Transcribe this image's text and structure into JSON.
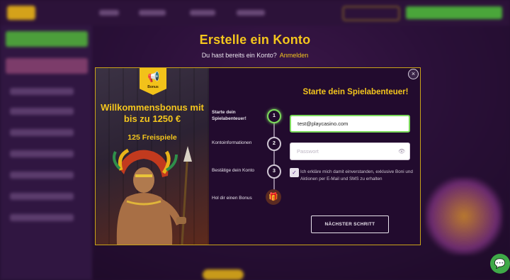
{
  "header": {
    "title": "Erstelle ein Konto",
    "subtitle": "Du hast bereits ein Konto?",
    "login_link": "Anmelden"
  },
  "promo": {
    "badge_label": "Bonus",
    "headline": "Willkommensbonus mit bis zu 1250 €",
    "freespins": "125 Freispiele"
  },
  "steps": [
    {
      "number": "1",
      "label": "Starte dein Spielabenteuer!",
      "active": true
    },
    {
      "number": "2",
      "label": "Kontoinformationen"
    },
    {
      "number": "3",
      "label": "Bestätige dein Konto"
    },
    {
      "label": "Hol dir einen Bonus",
      "icon": "gift-icon"
    }
  ],
  "form": {
    "title": "Starte dein Spielabenteuer!",
    "email_value": "test@playcasino.com",
    "password_placeholder": "Passwort",
    "consent_text": "Ich erkläre mich damit einverstanden, exklusive Boni und Aktionen per E-Mail und SMS zu erhalten",
    "consent_checked": true,
    "next_button": "NÄCHSTER SCHRITT"
  },
  "colors": {
    "accent_yellow": "#f4c61d",
    "active_green": "#7bd95b",
    "modal_bg": "#220b2e",
    "chat_green": "#3fa948"
  }
}
